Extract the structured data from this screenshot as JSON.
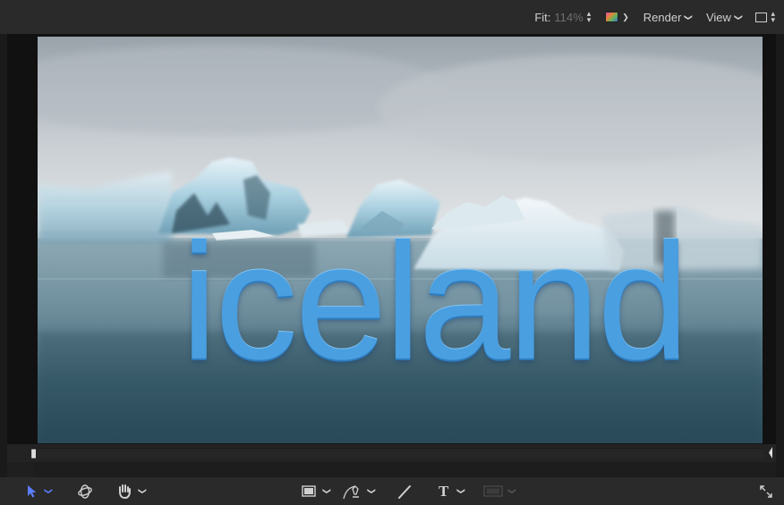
{
  "topbar": {
    "fit_label": "Fit:",
    "fit_value": "114%",
    "render_label": "Render",
    "view_label": "View"
  },
  "canvas": {
    "overlay_text": "iceland",
    "text_color": "#4a9fe0"
  },
  "toolbar": {
    "tools": [
      {
        "name": "select-tool",
        "icon": "arrow-pointer-icon"
      },
      {
        "name": "transform-3d-tool",
        "icon": "orbit-icon"
      },
      {
        "name": "pan-tool",
        "icon": "hand-icon"
      },
      {
        "name": "rectangle-tool",
        "icon": "rectangle-icon"
      },
      {
        "name": "bezier-tool",
        "icon": "pen-icon"
      },
      {
        "name": "paint-stroke-tool",
        "icon": "brush-icon"
      },
      {
        "name": "text-tool",
        "icon": "text-icon",
        "glyph": "T"
      },
      {
        "name": "mask-tool",
        "icon": "mask-icon"
      },
      {
        "name": "full-screen",
        "icon": "expand-icon"
      }
    ]
  },
  "colors": {
    "accent": "#5b7dff",
    "panel_bg": "#2a2a2a"
  }
}
